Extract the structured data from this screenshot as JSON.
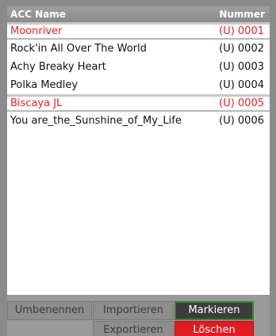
{
  "header": {
    "col_name": "ACC Name",
    "col_number": "Nummer"
  },
  "rows": [
    {
      "name": "Moonriver",
      "number": "(U) 0001",
      "selected": true
    },
    {
      "name": "Rock'in All Over The World",
      "number": "(U) 0002",
      "selected": false
    },
    {
      "name": "Achy Breaky Heart",
      "number": "(U) 0003",
      "selected": false
    },
    {
      "name": "Polka Medley",
      "number": "(U) 0004",
      "selected": false
    },
    {
      "name": "Biscaya JL",
      "number": "(U) 0005",
      "selected": true
    },
    {
      "name": "You are_the_Sunshine_of_My_Life",
      "number": "(U) 0006",
      "selected": false
    }
  ],
  "buttons": {
    "rename": "Umbenennen",
    "import": "Importieren",
    "mark": "Markieren",
    "export": "Exportieren",
    "delete": "Löschen"
  },
  "colors": {
    "selected_text": "#e8202a",
    "delete_button": "#e11b22",
    "mark_border": "#2f8a2f",
    "header_bg": "#959595"
  }
}
